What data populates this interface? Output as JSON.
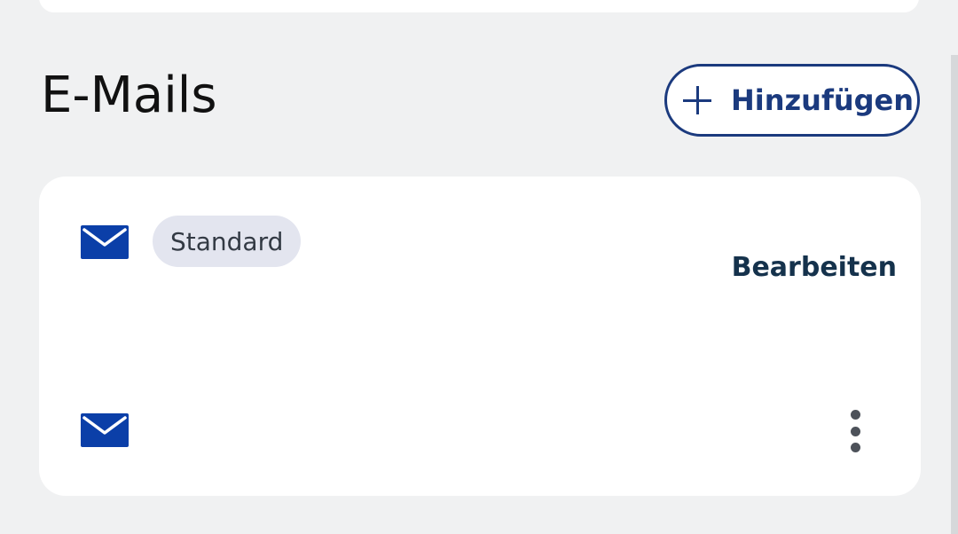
{
  "section": {
    "title": "E-Mails",
    "add_label": "Hinzufügen"
  },
  "emails": [
    {
      "icon": "mail-icon",
      "badge": "Standard",
      "action_label": "Bearbeiten"
    },
    {
      "icon": "mail-icon",
      "action_icon": "more-vertical-icon"
    }
  ],
  "colors": {
    "background": "#f0f1f2",
    "card": "#ffffff",
    "accent": "#1b3a7e",
    "mail_icon": "#0b3fa8",
    "badge_bg": "#e3e5ef",
    "edit_text": "#15324c"
  }
}
